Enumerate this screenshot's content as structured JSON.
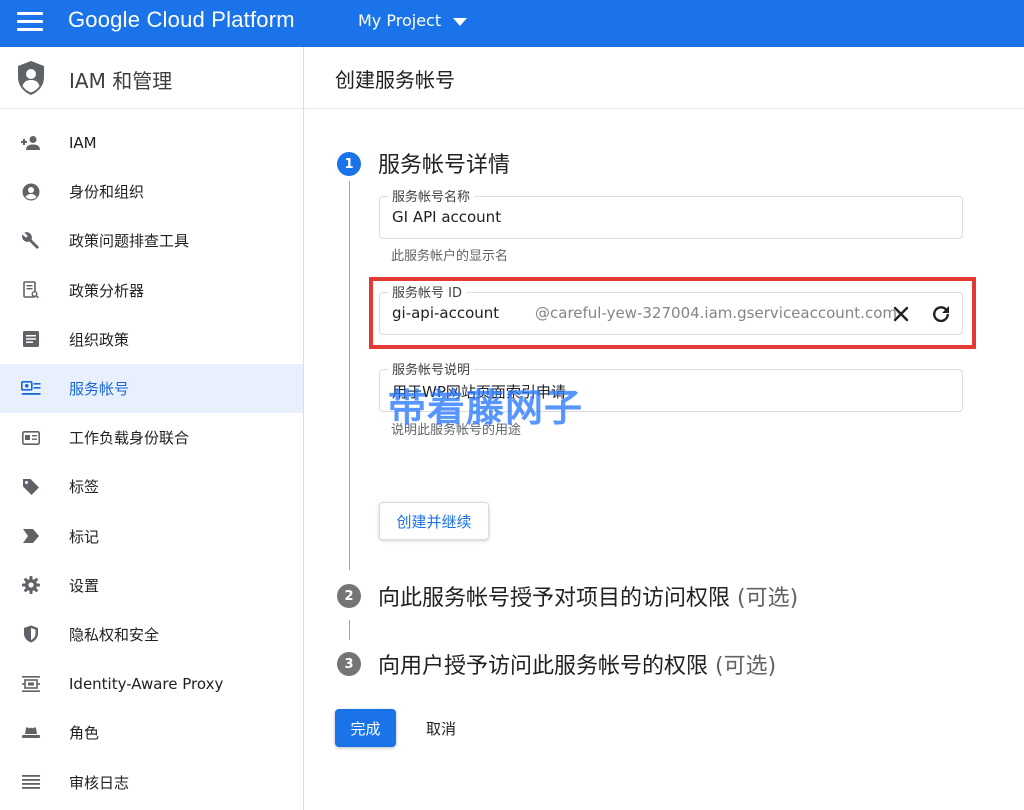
{
  "topbar": {
    "brand": "Google Cloud Platform",
    "project": "My Project",
    "menu_icon": "hamburger-menu-icon",
    "color": "#1a73e8"
  },
  "sidebar": {
    "title": "IAM 和管理",
    "items": [
      {
        "label": "IAM",
        "icon": "person-add-icon"
      },
      {
        "label": "身份和组织",
        "icon": "account-circle-icon"
      },
      {
        "label": "政策问题排查工具",
        "icon": "wrench-icon"
      },
      {
        "label": "政策分析器",
        "icon": "document-search-icon"
      },
      {
        "label": "组织政策",
        "icon": "list-document-icon"
      },
      {
        "label": "服务帐号",
        "icon": "service-account-icon",
        "active": true
      },
      {
        "label": "工作负载身份联合",
        "icon": "id-card-icon"
      },
      {
        "label": "标签",
        "icon": "tag-icon"
      },
      {
        "label": "标记",
        "icon": "label-arrow-icon"
      },
      {
        "label": "设置",
        "icon": "gear-icon"
      },
      {
        "label": "隐私权和安全",
        "icon": "shield-icon"
      },
      {
        "label": "Identity-Aware Proxy",
        "icon": "proxy-icon"
      },
      {
        "label": "角色",
        "icon": "hat-icon"
      },
      {
        "label": "审核日志",
        "icon": "list-icon"
      }
    ]
  },
  "main": {
    "title": "创建服务帐号",
    "step1": {
      "number": "1",
      "title": "服务帐号详情",
      "name_label": "服务帐号名称",
      "name_value": "GI API account",
      "name_hint": "此服务帐户的显示名",
      "id_label": "服务帐号 ID",
      "id_value": "gi-api-account",
      "id_suffix": "@careful-yew-327004.iam.gserviceaccount.com",
      "desc_label": "服务帐号说明",
      "desc_value": "用于WP网站页面索引申请",
      "desc_hint": "说明此服务帐号的用途",
      "continue_button": "创建并继续"
    },
    "step2": {
      "number": "2",
      "title": "向此服务帐号授予对项目的访问权限",
      "optional": "(可选)"
    },
    "step3": {
      "number": "3",
      "title": "向用户授予访问此服务帐号的权限",
      "optional": "(可选)"
    },
    "done_button": "完成",
    "cancel_button": "取消"
  },
  "watermark": "带着藤网子",
  "colors": {
    "accent": "#1a73e8",
    "highlight": "#e53935",
    "active_bg": "#e8f0fe"
  }
}
